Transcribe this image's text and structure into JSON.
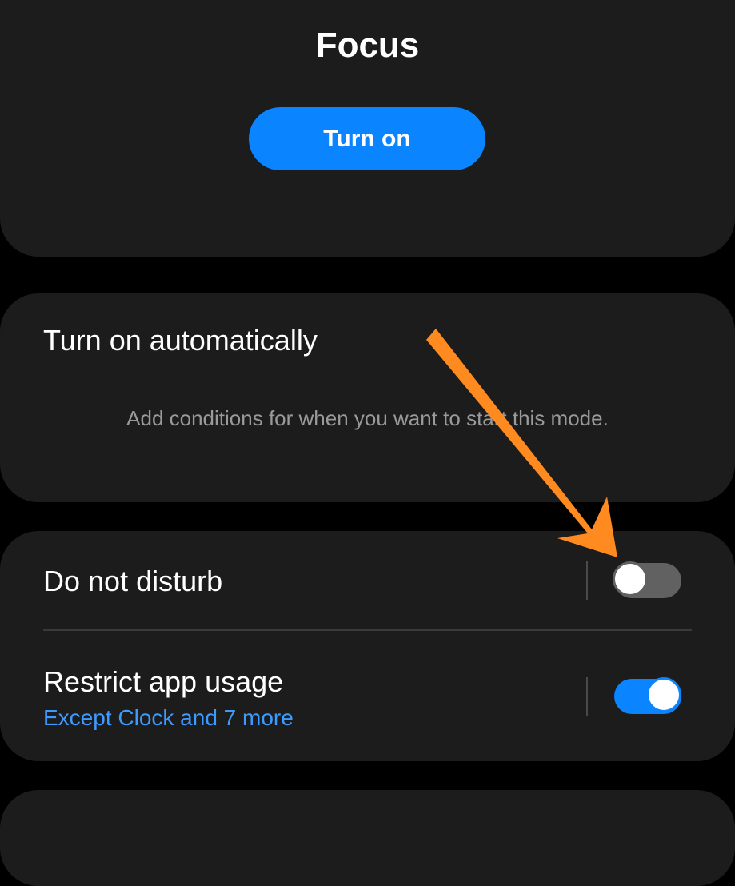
{
  "mode": {
    "title": "Focus",
    "turn_on_label": "Turn on"
  },
  "auto": {
    "title": "Turn on automatically",
    "description": "Add conditions for when you want to start this mode."
  },
  "settings": {
    "dnd": {
      "label": "Do not disturb",
      "enabled": false
    },
    "restrict": {
      "label": "Restrict app usage",
      "subtitle": "Except Clock and 7 more",
      "enabled": true
    }
  },
  "colors": {
    "accent": "#0a84ff",
    "link": "#3d9bff",
    "annotation_arrow": "#ff8a1f",
    "card_background": "#1c1c1c"
  }
}
